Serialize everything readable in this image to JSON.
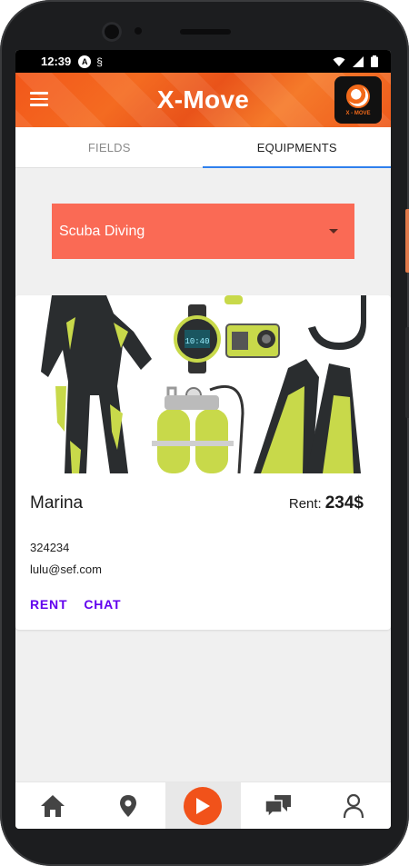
{
  "status_bar": {
    "time": "12:39",
    "icons": [
      "android-a-icon",
      "sync-icon"
    ],
    "right_icons": [
      "wifi-icon",
      "signal-icon",
      "battery-icon"
    ]
  },
  "app_bar": {
    "title": "X-Move",
    "menu_icon": "menu-icon",
    "logo_text": "X - MOVE"
  },
  "tabs": [
    {
      "label": "FIELDS",
      "active": false
    },
    {
      "label": "EQUIPMENTS",
      "active": true
    }
  ],
  "category_dropdown": {
    "selected": "Scuba Diving"
  },
  "equipment_card": {
    "image_alt": "scuba diving equipment",
    "owner_name": "Marina",
    "rent_label": "Rent:",
    "rent_price": "234$",
    "phone": "324234",
    "email": "lulu@sef.com",
    "actions": {
      "rent": "RENT",
      "chat": "CHAT"
    }
  },
  "bottom_nav": [
    {
      "name": "home-icon",
      "active": false
    },
    {
      "name": "location-icon",
      "active": false
    },
    {
      "name": "play-icon",
      "active": true
    },
    {
      "name": "chat-icon",
      "active": false
    },
    {
      "name": "profile-icon",
      "active": false
    }
  ],
  "colors": {
    "accent": "#f2571a",
    "dropdown": "#fa6a55",
    "action_text": "#6200ee",
    "tab_indicator": "#2f80ed",
    "equipment_green": "#c8d94a"
  }
}
